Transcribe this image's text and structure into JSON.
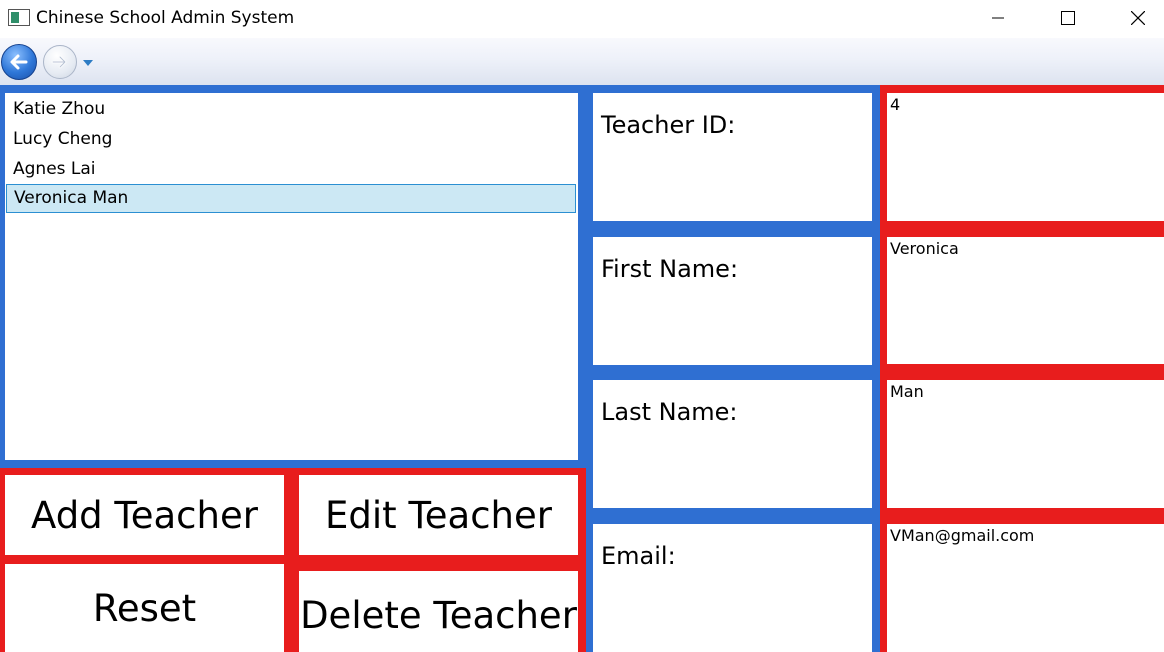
{
  "window": {
    "title": "Chinese School Admin System"
  },
  "nav": {
    "back_icon": "arrow-left-icon",
    "forward_icon": "arrow-right-icon",
    "dropdown_icon": "caret-down-icon"
  },
  "teachers": [
    {
      "name": "Katie Zhou"
    },
    {
      "name": "Lucy Cheng"
    },
    {
      "name": "Agnes Lai"
    },
    {
      "name": "Veronica Man",
      "selected": true
    }
  ],
  "actions": {
    "add": "Add Teacher",
    "edit": "Edit Teacher",
    "reset": "Reset",
    "delete": "Delete Teacher"
  },
  "form": {
    "id_label": "Teacher ID:",
    "first_label": "First Name:",
    "last_label": "Last Name:",
    "email_label": "Email:",
    "id_value": "4",
    "first_value": "Veronica",
    "last_value": "Man",
    "email_value": "VMan@gmail.com"
  },
  "colors": {
    "blue_border": "#2f6fd2",
    "red_border": "#e81d1d",
    "selection": "#cce8f4"
  }
}
